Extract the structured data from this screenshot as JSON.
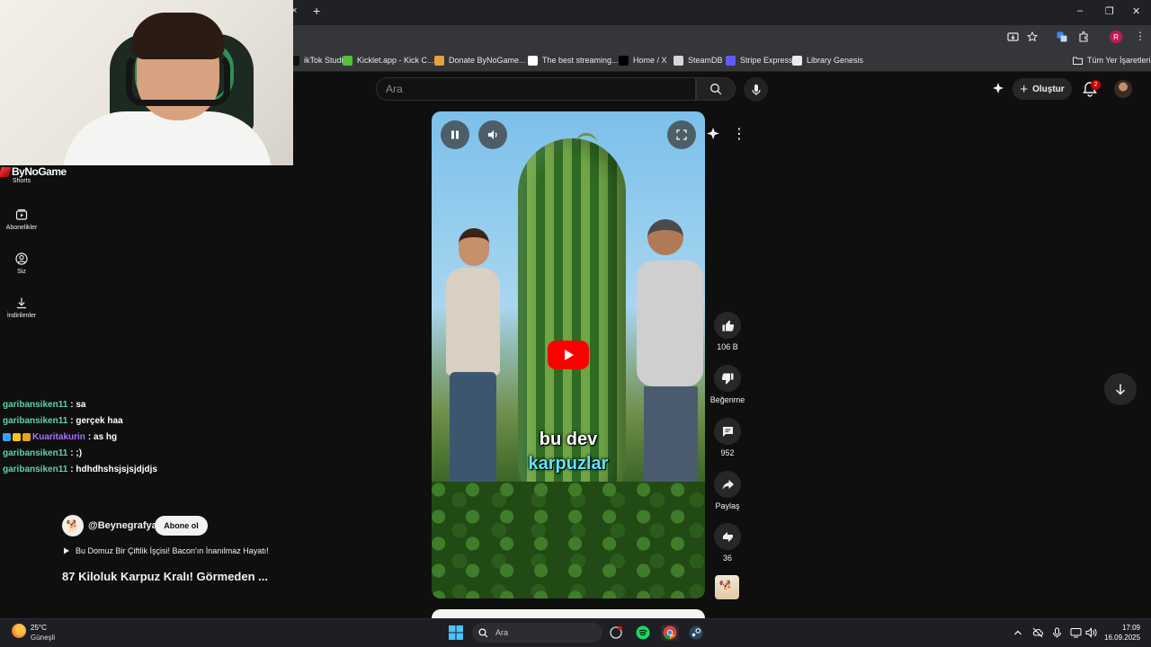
{
  "browser": {
    "new_tab_symbol": "+",
    "close_tab_symbol": "×",
    "bookmarks": [
      {
        "label": "ikTok Studio",
        "color": "#111111"
      },
      {
        "label": "Kicklet.app - Kick C...",
        "color": "#53c23b"
      },
      {
        "label": "Donate ByNoGame...",
        "color": "#e6a23c"
      },
      {
        "label": "The best streaming...",
        "color": "#ffffff"
      },
      {
        "label": "Home / X",
        "color": "#000000"
      },
      {
        "label": "SteamDB",
        "color": "#d6d6d6"
      },
      {
        "label": "Stripe Express",
        "color": "#635bff"
      },
      {
        "label": "Library Genesis",
        "color": "#e8eaed"
      }
    ],
    "all_bookmarks_label": "Tüm Yer İşaretleri",
    "profile_initial": "R"
  },
  "webcam": {
    "overlay_brand": "ByNoGame"
  },
  "sidebar": {
    "items": [
      {
        "label": "Shorts",
        "icon": "shorts-icon"
      },
      {
        "label": "Abonelikler",
        "icon": "subscriptions-icon"
      },
      {
        "label": "Siz",
        "icon": "you-icon"
      },
      {
        "label": "İndirilenler",
        "icon": "downloads-icon"
      }
    ]
  },
  "header": {
    "search_placeholder": "Ara",
    "create_label": "Oluştur",
    "notification_count": "2"
  },
  "video": {
    "caption_line1": "bu dev",
    "caption_line2": "karpuzlar"
  },
  "actions": {
    "like_count": "106 B",
    "dislike_label": "Beğenme",
    "comment_count": "952",
    "share_label": "Paylaş",
    "remix_count": "36"
  },
  "chat": [
    {
      "user": "garibansiken11",
      "message": ": sa",
      "color": "#5fd3a6",
      "badges": []
    },
    {
      "user": "garibansiken11",
      "message": ": gerçek haa",
      "color": "#5fd3a6",
      "badges": []
    },
    {
      "user": "Kuaritakurin",
      "message": ": as hg",
      "color": "#a970ff",
      "badges": [
        "#3aa0ff",
        "#f5c518",
        "#e8a317"
      ]
    },
    {
      "user": "garibansiken11",
      "message": ": ;)",
      "color": "#5fd3a6",
      "badges": []
    },
    {
      "user": "garibansiken11",
      "message": ": hdhdhshsjsjsjdjdjs",
      "color": "#5fd3a6",
      "badges": []
    }
  ],
  "channel": {
    "handle": "@Beynegrafya",
    "subscribe_label": "Abone ol",
    "playlist_title": "Bu Domuz Bir Çiftlik İşçisi! Bacon'ın İnanılmaz Hayatı!",
    "video_title": "87 Kiloluk Karpuz Kralı! Görmeden ..."
  },
  "taskbar": {
    "temperature": "25°C",
    "condition": "Güneşli",
    "search_placeholder": "Ara",
    "time": "17:09",
    "date": "16.09.2025"
  }
}
